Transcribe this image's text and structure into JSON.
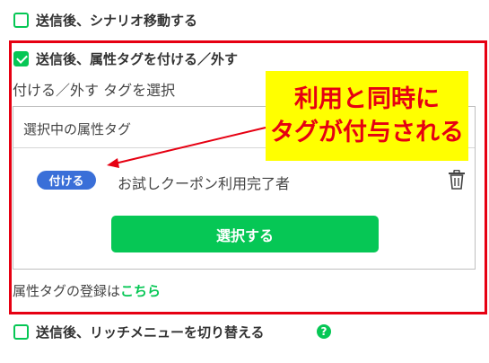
{
  "options": [
    {
      "label": "送信後、シナリオ移動する",
      "checked": false
    },
    {
      "label": "送信後、属性タグを付ける／外す",
      "checked": true
    },
    {
      "label": "送信後、リッチメニューを切り替える",
      "checked": false
    }
  ],
  "tag_section": {
    "sub_label": "付ける／外す タグを選択",
    "panel_title": "選択中の属性タグ",
    "item": {
      "action_badge": "付ける",
      "tag_name": "お試しクーポン利用完了者",
      "delete_icon": "trash-icon"
    },
    "select_button": "選択する",
    "register_text": "属性タグの登録は",
    "register_link": "こちら"
  },
  "callout": {
    "line1": "利用と同時に",
    "line2": "タグが付与される"
  },
  "help_icon": "?",
  "colors": {
    "accent": "#06c755",
    "highlight_border": "#e60012",
    "badge": "#3a6fd8",
    "callout_bg": "#ffff00",
    "callout_text": "#e60012"
  }
}
